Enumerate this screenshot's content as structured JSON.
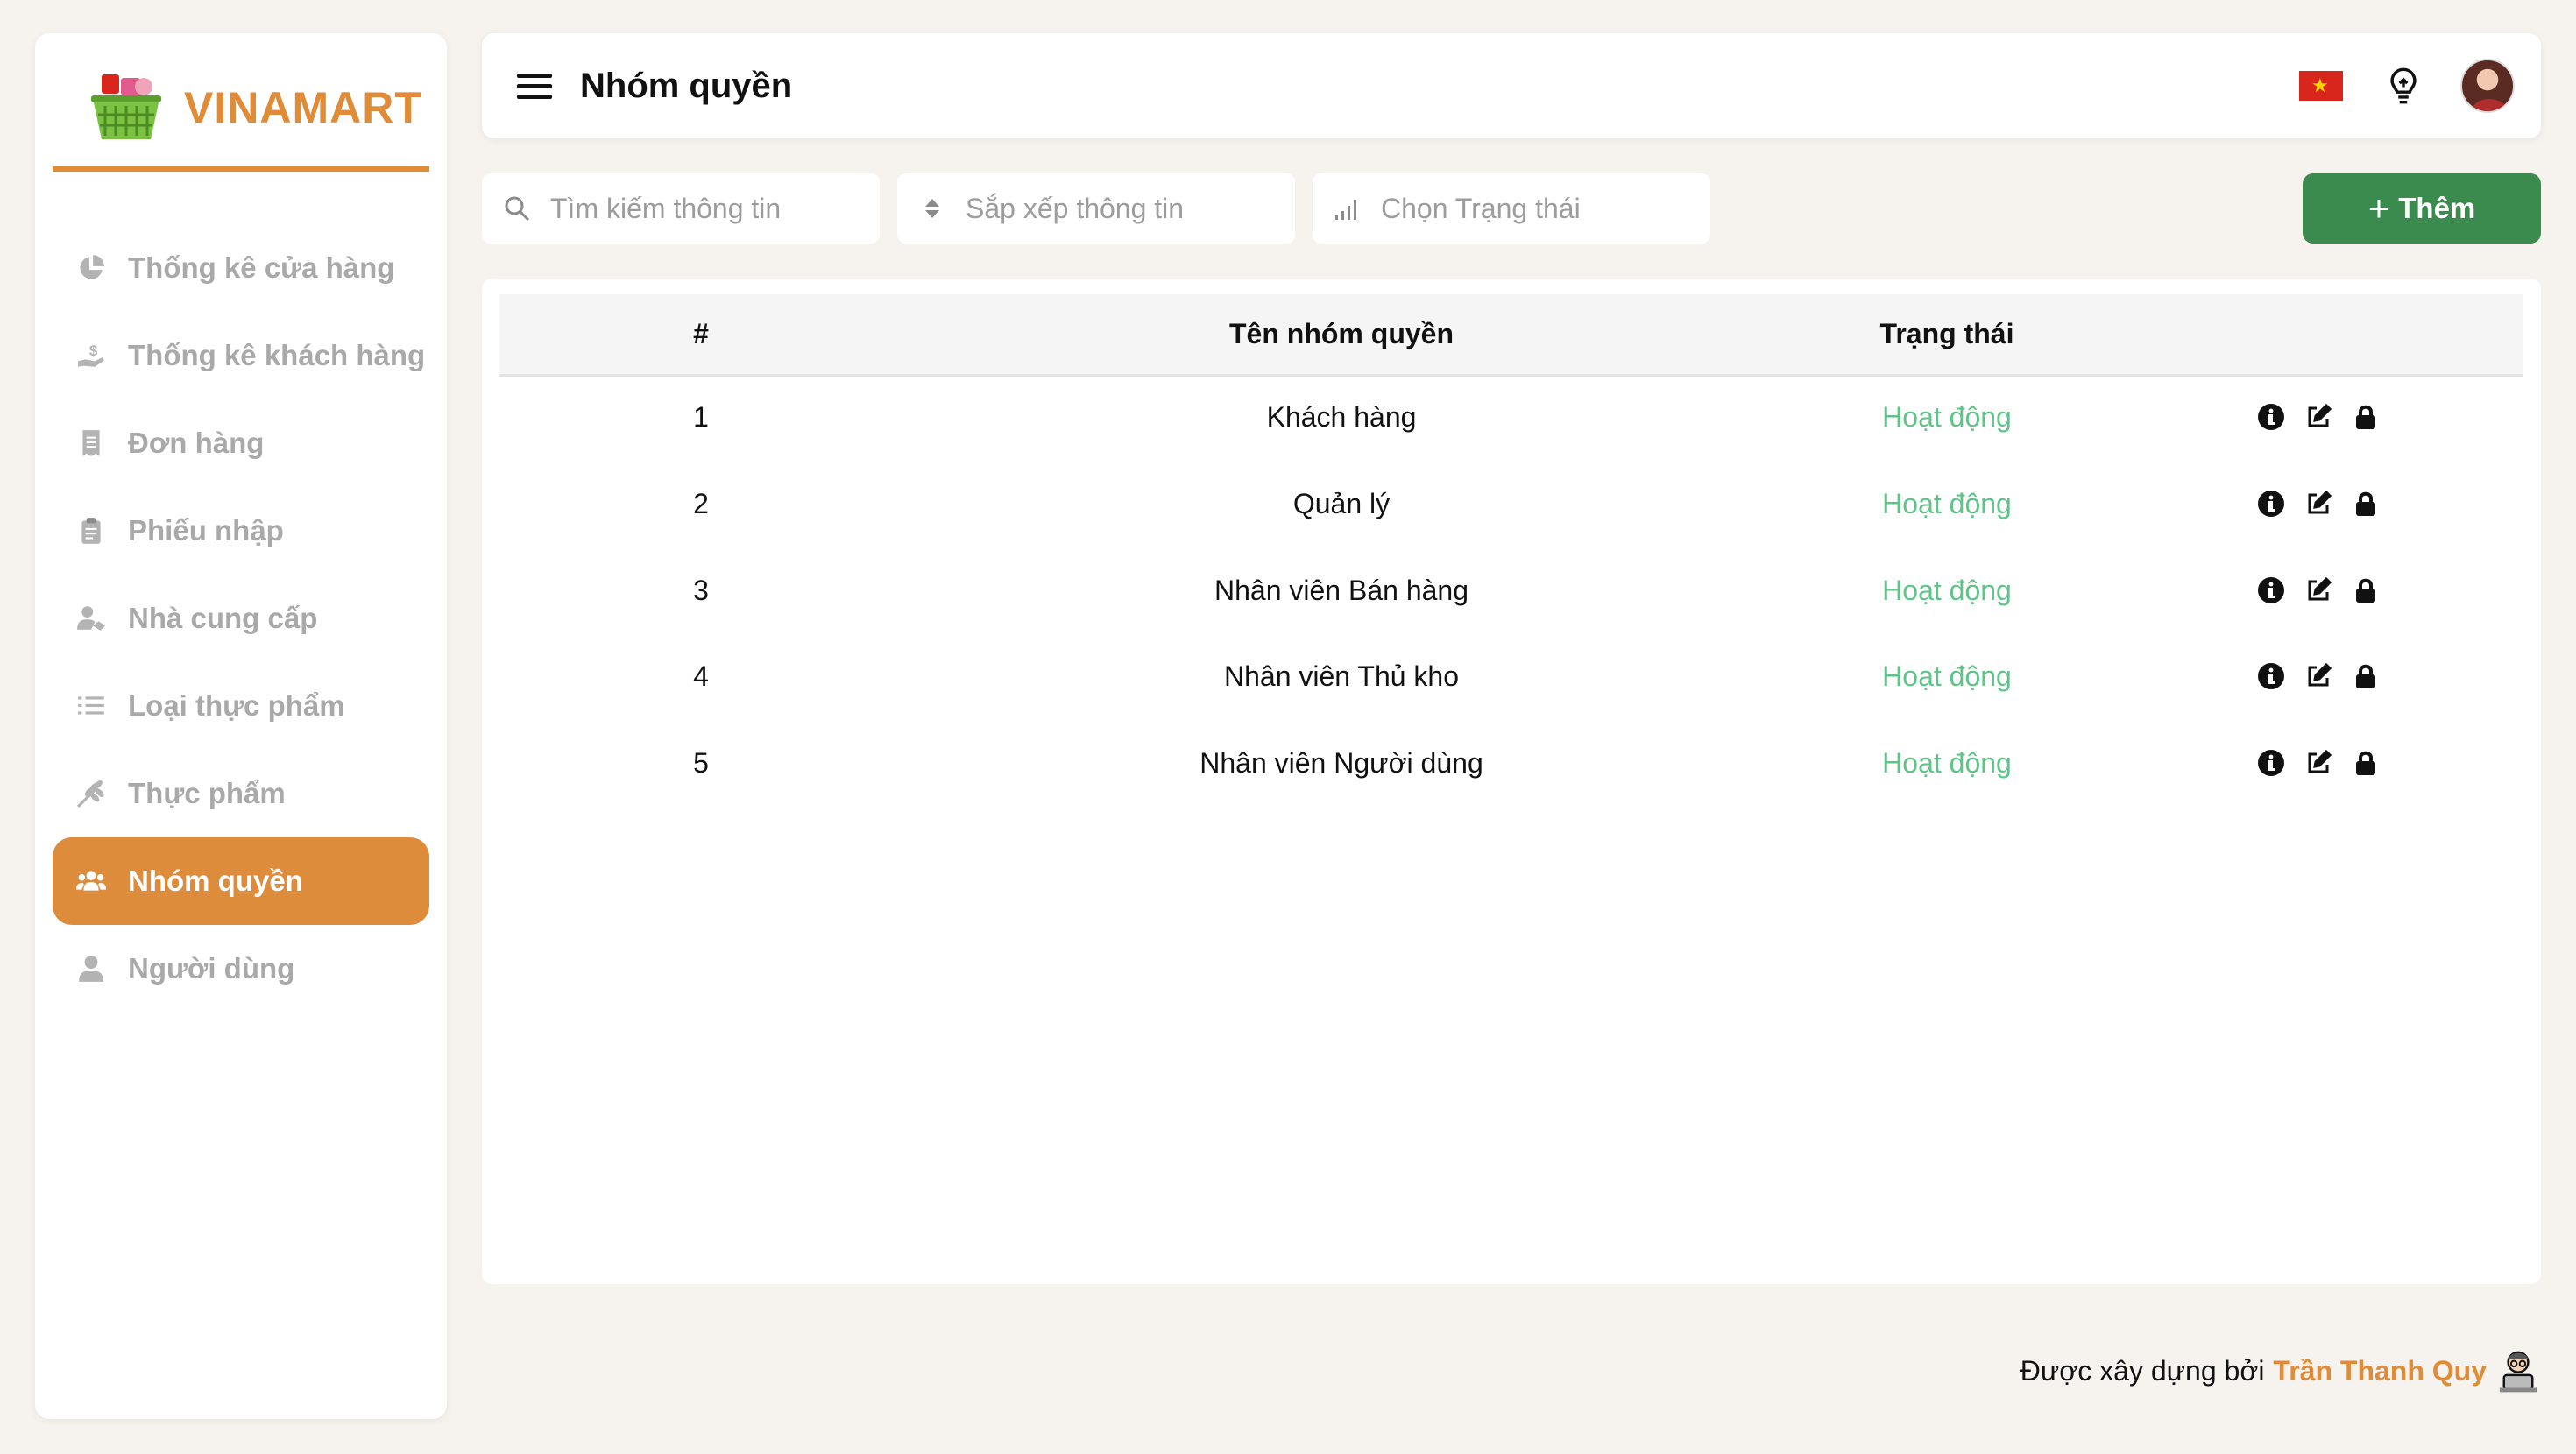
{
  "brand": {
    "name": "VINAMART",
    "logo_icon": "basket-icon"
  },
  "sidebar": {
    "items": [
      {
        "label": "Thống kê cửa hàng",
        "icon": "pie-chart-icon",
        "active": false
      },
      {
        "label": "Thống kê khách hàng",
        "icon": "hand-dollar-icon",
        "active": false
      },
      {
        "label": "Đơn hàng",
        "icon": "receipt-icon",
        "active": false
      },
      {
        "label": "Phiếu nhập",
        "icon": "clipboard-icon",
        "active": false
      },
      {
        "label": "Nhà cung cấp",
        "icon": "user-handshake-icon",
        "active": false
      },
      {
        "label": "Loại thực phẩm",
        "icon": "list-icon",
        "active": false
      },
      {
        "label": "Thực phẩm",
        "icon": "wheat-icon",
        "active": false
      },
      {
        "label": "Nhóm quyền",
        "icon": "users-group-icon",
        "active": true
      },
      {
        "label": "Người dùng",
        "icon": "user-icon",
        "active": false
      }
    ]
  },
  "header": {
    "title": "Nhóm quyền",
    "menu_icon": "hamburger-icon",
    "flag_icon": "vietnam-flag-icon",
    "bulb_icon": "lightbulb-icon",
    "avatar_icon": "avatar"
  },
  "filters": {
    "search_placeholder": "Tìm kiếm thông tin",
    "sort_placeholder": "Sắp xếp thông tin",
    "status_placeholder": "Chọn Trạng thái"
  },
  "add_button": {
    "label": "Thêm"
  },
  "table": {
    "headers": {
      "index": "#",
      "name": "Tên nhóm quyền",
      "status": "Trạng thái"
    },
    "rows": [
      {
        "index": "1",
        "name": "Khách hàng",
        "status": "Hoạt động"
      },
      {
        "index": "2",
        "name": "Quản lý",
        "status": "Hoạt động"
      },
      {
        "index": "3",
        "name": "Nhân viên Bán hàng",
        "status": "Hoạt động"
      },
      {
        "index": "4",
        "name": "Nhân viên Thủ kho",
        "status": "Hoạt động"
      },
      {
        "index": "5",
        "name": "Nhân viên Người dùng",
        "status": "Hoạt động"
      }
    ]
  },
  "footer": {
    "text": "Được xây dựng bởi",
    "author": "Trần Thanh Quy"
  },
  "colors": {
    "accent": "#dd8c3c",
    "add_button": "#3b8b4e",
    "status_active": "#5fc488",
    "background": "#f6f3ef"
  }
}
